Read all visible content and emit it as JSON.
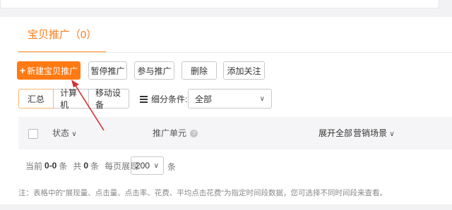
{
  "tab": {
    "title": "宝贝推广（0）"
  },
  "toolbar": {
    "new_label": "新建宝贝推广",
    "pause_label": "暂停推广",
    "join_label": "参与推广",
    "delete_label": "删除",
    "follow_label": "添加关注"
  },
  "segment": {
    "items": [
      "汇总",
      "计算机",
      "移动设备"
    ],
    "selected": "汇总"
  },
  "filter": {
    "label": "细分条件:",
    "selected": "全部",
    "icon": "list-icon"
  },
  "table": {
    "headers": {
      "status": "状态",
      "unit": "推广单元",
      "expand": "展开全部",
      "scene": "营销场景"
    }
  },
  "pager": {
    "current_prefix": "当前",
    "current_range": "0-0",
    "current_suffix": "条",
    "total_prefix": "共",
    "total_count": "0",
    "total_suffix": "条",
    "per_page_label": "每页展现",
    "page_size": "200",
    "unit": "条"
  },
  "note": "注：表格中的\"展现量、点击量、点击率、花费、平均点击花费\"为指定时间段数据，您可选择不同时间段来查看。",
  "colors": {
    "accent": "#ff7a12",
    "arrow": "#d32f2f"
  }
}
